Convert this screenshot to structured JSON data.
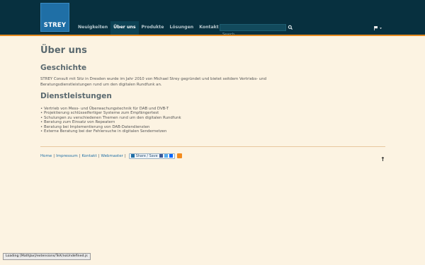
{
  "header": {
    "logo_text": "STREY",
    "nav": [
      {
        "label": "Neuigkeiten",
        "active": false
      },
      {
        "label": "Über uns",
        "active": true
      },
      {
        "label": "Produkte",
        "active": false
      },
      {
        "label": "Lösungen",
        "active": false
      },
      {
        "label": "Kontakt",
        "active": false
      }
    ],
    "search_placeholder": "Search",
    "search_icon": "search-icon",
    "language_flag": "flag-icon"
  },
  "main": {
    "title": "Über uns",
    "history_heading": "Geschichte",
    "history_text": "STREY Consult mit Sitz in Dresden wurde im Jahr 2010 von Michael Strey gegründet und bietet seitdem Vertriebs- und Beratungsdienstleistungen rund um den digitalen Rundfunk an.",
    "services_heading": "Dienstleistungen",
    "services": [
      "Vertrieb von Mess- und Überwachungstechnik für DAB und DVB-T",
      "Projektierung schlüsselfertiger Systeme zum Empfängertest",
      "Schulungen zu verschiedenen Themen rund um den digitalen Rundfunk",
      "Beratung zum Einsatz von Repeatern",
      "Beratung bei Implementierung von DAB-Datendiensten",
      "Externe Beratung bei der Fehlersuche in digitalen Sendernetzen"
    ]
  },
  "footer": {
    "links": [
      "Home",
      "Impressum",
      "Kontakt",
      "Webmaster"
    ],
    "separator": "|",
    "share_label": "Share / Save",
    "rss_icon": "rss-icon",
    "top_arrow": "↑"
  },
  "status_text": "Loading [MathJax]/extensions/TeX/noUndefined.js",
  "colors": {
    "header_bg": "#07303f",
    "accent_line": "#e58a1f",
    "page_bg": "#fcf3e2",
    "link": "#1f6fa6"
  }
}
